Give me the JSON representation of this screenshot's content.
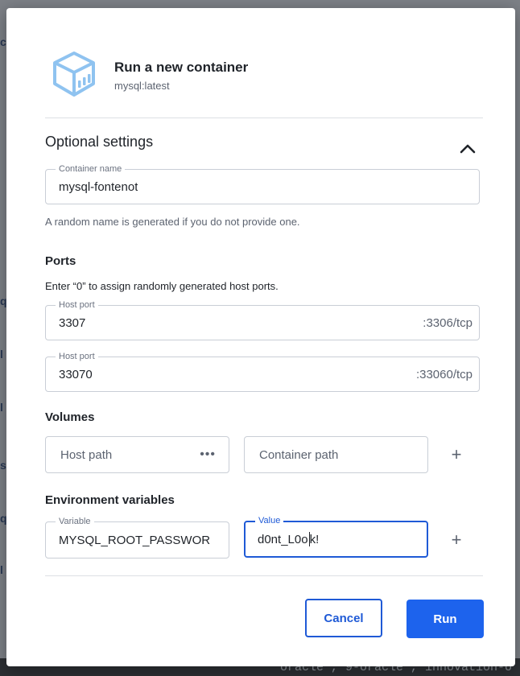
{
  "background": {
    "bottom_text": "oracle , 9-oracle , innovation-o"
  },
  "dialog": {
    "title": "Run a new container",
    "image": "mysql:latest",
    "icon": "container-cube-icon"
  },
  "optional": {
    "title": "Optional settings",
    "expanded": true
  },
  "container_name": {
    "legend": "Container name",
    "value": "mysql-fontenot",
    "helper": "A random name is generated if you do not provide one."
  },
  "ports": {
    "title": "Ports",
    "description": "Enter “0” to assign randomly generated host ports.",
    "items": [
      {
        "legend": "Host port",
        "value": "3307",
        "container_port": ":3306/tcp"
      },
      {
        "legend": "Host port",
        "value": "33070",
        "container_port": ":33060/tcp"
      }
    ]
  },
  "volumes": {
    "title": "Volumes",
    "host_placeholder": "Host path",
    "host_dots": "•••",
    "container_placeholder": "Container path",
    "add": "+"
  },
  "env": {
    "title": "Environment variables",
    "variable_legend": "Variable",
    "variable_value": "MYSQL_ROOT_PASSWOR",
    "value_legend": "Value",
    "value_before_caret": "d0nt_L0o",
    "value_after_caret": "k!",
    "add": "+"
  },
  "buttons": {
    "cancel": "Cancel",
    "run": "Run"
  },
  "colors": {
    "primary": "#1d63ed",
    "focus": "#1f5ad6",
    "icon": "#8fc3f0"
  }
}
